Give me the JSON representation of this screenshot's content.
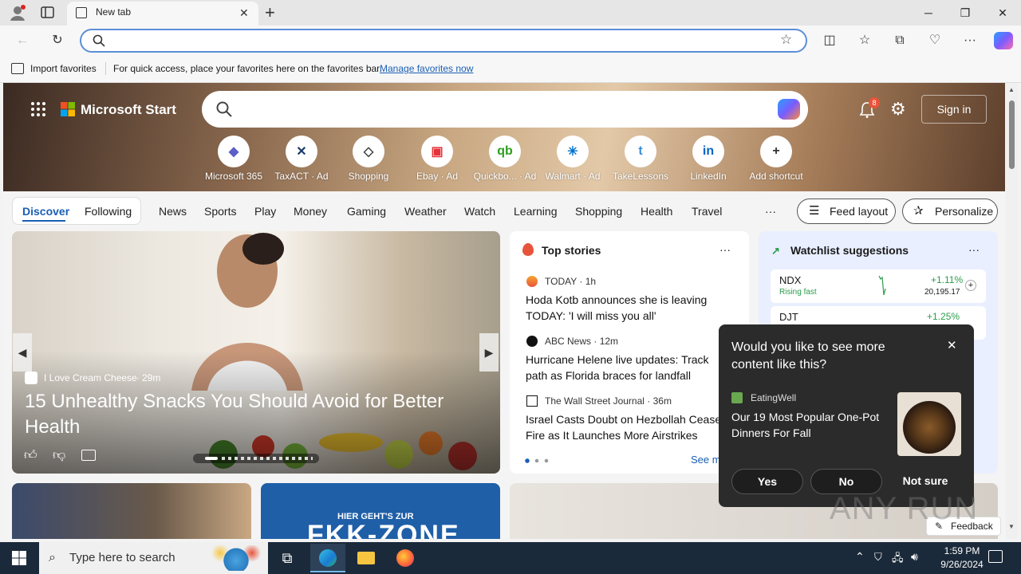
{
  "browser": {
    "tab_title": "New tab",
    "new_tab_symbol": "+",
    "address_placeholder": "",
    "favorites_bar": {
      "import_label": "Import favorites",
      "hint": "For quick access, place your favorites here on the favorites bar.",
      "manage_link": "Manage favorites now"
    }
  },
  "header": {
    "brand": "Microsoft Start",
    "notification_count": "8",
    "sign_in": "Sign in"
  },
  "shortcuts": [
    {
      "label": "Microsoft 365",
      "icon": "microsoft-365-icon",
      "glyph": "◆",
      "color": "#5b5fc7"
    },
    {
      "label": "TaxACT · Ad",
      "icon": "taxact-icon",
      "glyph": "✕",
      "color": "#1a3a6b"
    },
    {
      "label": "Shopping",
      "icon": "shopping-tag-icon",
      "glyph": "◇",
      "color": "#444444"
    },
    {
      "label": "Ebay · Ad",
      "icon": "ebay-bag-icon",
      "glyph": "▣",
      "color": "#e53238"
    },
    {
      "label": "Quickbo... · Ad",
      "icon": "quickbooks-icon",
      "glyph": "qb",
      "color": "#2ca01c"
    },
    {
      "label": "Walmart · Ad",
      "icon": "walmart-icon",
      "glyph": "✳",
      "color": "#0071ce"
    },
    {
      "label": "TakeLessons",
      "icon": "takelessons-icon",
      "glyph": "t",
      "color": "#3a8fd9"
    },
    {
      "label": "LinkedIn",
      "icon": "linkedin-icon",
      "glyph": "in",
      "color": "#0a66c2"
    },
    {
      "label": "Add shortcut",
      "icon": "add-icon",
      "glyph": "+",
      "color": "#333333"
    }
  ],
  "nav": {
    "discover": "Discover",
    "following": "Following",
    "items": [
      "News",
      "Sports",
      "Play",
      "Money",
      "Gaming",
      "Weather",
      "Watch",
      "Learning",
      "Shopping",
      "Health",
      "Travel"
    ],
    "more": "···",
    "feed_layout": "Feed layout",
    "personalize": "Personalize"
  },
  "hero": {
    "source": "I Love Cream Cheese",
    "age": "29m",
    "title": "15 Unhealthy Snacks You Should Avoid for Better Health"
  },
  "top_stories": {
    "title": "Top stories",
    "more": "···",
    "items": [
      {
        "source": "TODAY",
        "age": "1h",
        "headline": "Hoda Kotb announces she is leaving TODAY: 'I will miss you all'"
      },
      {
        "source": "ABC News",
        "age": "12m",
        "headline": "Hurricane Helene live updates: Track path as Florida braces for landfall"
      },
      {
        "source": "The Wall Street Journal",
        "age": "36m",
        "headline": "Israel Casts Doubt on Hezbollah Cease-Fire as It Launches More Airstrikes"
      }
    ],
    "see_more": "See more"
  },
  "watchlist": {
    "title": "Watchlist suggestions",
    "more": "···",
    "stocks": [
      {
        "symbol": "NDX",
        "status": "Rising fast",
        "change": "+1.11%",
        "price": "20,195.17"
      },
      {
        "symbol": "DJT",
        "status": "",
        "change": "+1.25%",
        "price": ""
      }
    ]
  },
  "popup": {
    "question": "Would you like to see more content like this?",
    "source": "EatingWell",
    "headline": "Our 19 Most Popular One-Pot Dinners For Fall",
    "yes": "Yes",
    "no": "No",
    "not_sure": "Not sure"
  },
  "feedback": "Feedback",
  "cards_bottom": {
    "sign_line1": "HIER GEHT'S ZUR",
    "sign_line2": "FKK-ZONE"
  },
  "taskbar": {
    "search_placeholder": "Type here to search",
    "time": "1:59 PM",
    "date": "9/26/2024"
  },
  "watermark": "ANY RUN"
}
